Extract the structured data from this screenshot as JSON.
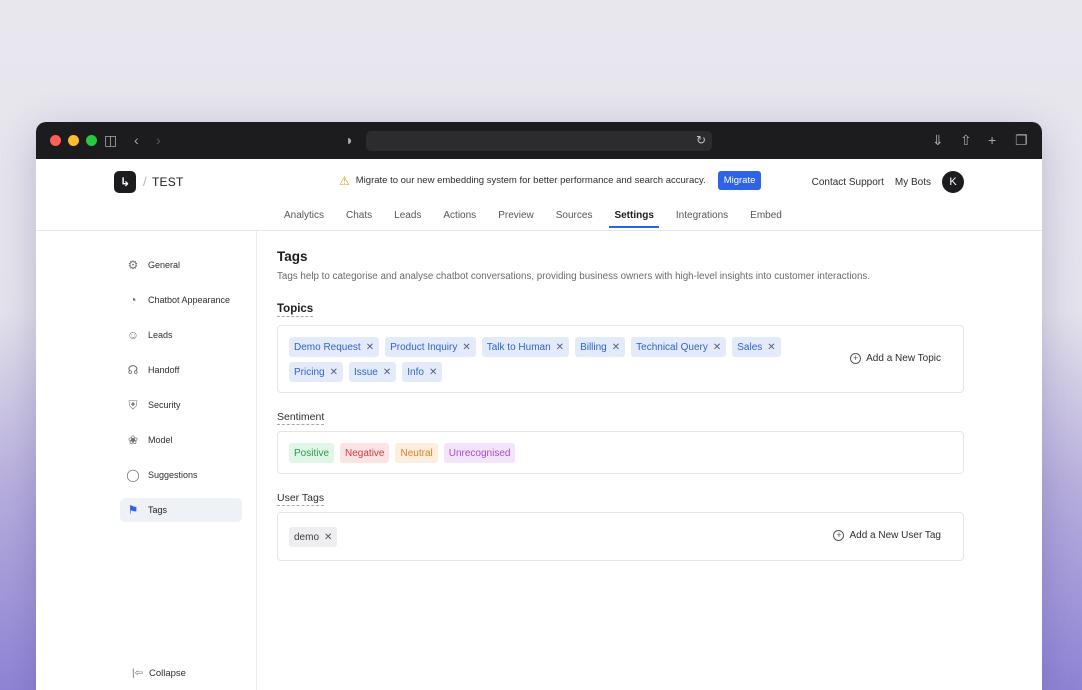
{
  "browser": {
    "traffic_lights": [
      "#ff5f57",
      "#febc2e",
      "#28c840"
    ],
    "icons": {
      "sidebar": "sidebar-toggle-icon",
      "back": "chevron-left-icon",
      "forward": "chevron-right-icon",
      "privacy": "shield-icon",
      "reload": "reload-icon",
      "download": "download-icon",
      "share": "share-icon",
      "new_tab": "plus-icon",
      "tabs": "tab-overview-icon"
    }
  },
  "header": {
    "project_name": "TEST",
    "crumb_separator": "/",
    "banner_text": "Migrate to our new embedding system for better performance and search accuracy.",
    "migrate_label": "Migrate",
    "contact_support": "Contact Support",
    "my_bots": "My Bots",
    "avatar_initial": "K",
    "accent_color": "#2f63e6"
  },
  "nav": {
    "tabs": [
      {
        "label": "Analytics"
      },
      {
        "label": "Chats"
      },
      {
        "label": "Leads"
      },
      {
        "label": "Actions"
      },
      {
        "label": "Preview"
      },
      {
        "label": "Sources"
      },
      {
        "label": "Settings",
        "active": true
      },
      {
        "label": "Integrations"
      },
      {
        "label": "Embed"
      }
    ]
  },
  "sidebar": {
    "items": [
      {
        "label": "General",
        "icon": "gear-icon"
      },
      {
        "label": "Chatbot Appearance",
        "icon": "palette-icon"
      },
      {
        "label": "Leads",
        "icon": "users-icon"
      },
      {
        "label": "Handoff",
        "icon": "headset-icon"
      },
      {
        "label": "Security",
        "icon": "shield-check-icon"
      },
      {
        "label": "Model",
        "icon": "brain-icon"
      },
      {
        "label": "Suggestions",
        "icon": "lightbulb-icon"
      },
      {
        "label": "Tags",
        "icon": "tag-icon",
        "active": true
      }
    ],
    "collapse_label": "Collapse"
  },
  "main": {
    "title": "Tags",
    "description": "Tags help to categorise and analyse chatbot conversations, providing business owners with high-level insights into customer interactions.",
    "topics": {
      "label": "Topics",
      "items": [
        "Demo Request",
        "Product Inquiry",
        "Talk to Human",
        "Billing",
        "Technical Query",
        "Sales",
        "Pricing",
        "Issue",
        "Info"
      ],
      "add_label": "Add a New Topic"
    },
    "sentiment": {
      "label": "Sentiment",
      "items": [
        "Positive",
        "Negative",
        "Neutral",
        "Unrecognised"
      ]
    },
    "user_tags": {
      "label": "User Tags",
      "items": [
        "demo"
      ],
      "add_label": "Add a New User Tag"
    }
  }
}
